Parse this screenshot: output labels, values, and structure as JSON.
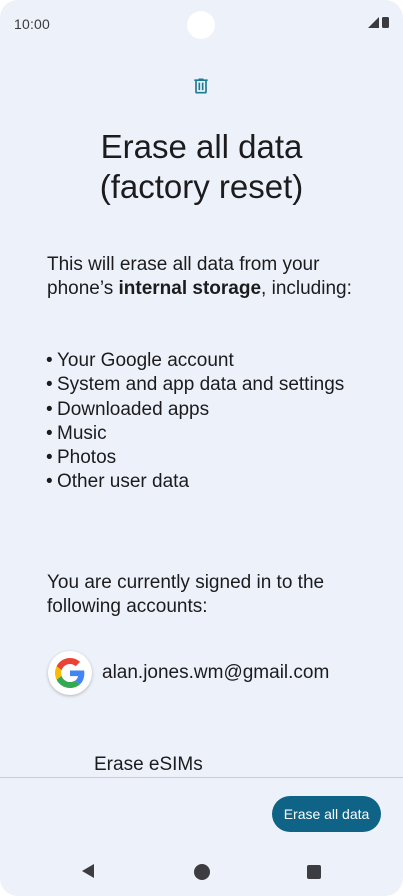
{
  "status_bar": {
    "time": "10:00"
  },
  "header": {
    "icon": "trash-icon",
    "title": "Erase all data\n(factory reset)"
  },
  "description": {
    "intro_start": "This will erase all data from your phone’s ",
    "intro_bold": "internal storage",
    "intro_end": ", including:"
  },
  "erase_items": [
    "Your Google account",
    "System and app data and settings",
    "Downloaded apps",
    "Music",
    "Photos",
    "Other user data"
  ],
  "accounts": {
    "signed_in_text": "You are currently signed in to the following accounts:",
    "email": "alan.jones.wm@gmail.com",
    "icon": "google-icon"
  },
  "esim": {
    "label": "Erase eSIMs"
  },
  "footer": {
    "erase_button_label": "Erase all data"
  },
  "colors": {
    "background": "#edf1f9",
    "accent": "#0e6386",
    "icon_teal": "#1b7c96"
  },
  "navigation": {
    "back": "back-icon",
    "home": "home-icon",
    "recents": "recents-icon"
  }
}
